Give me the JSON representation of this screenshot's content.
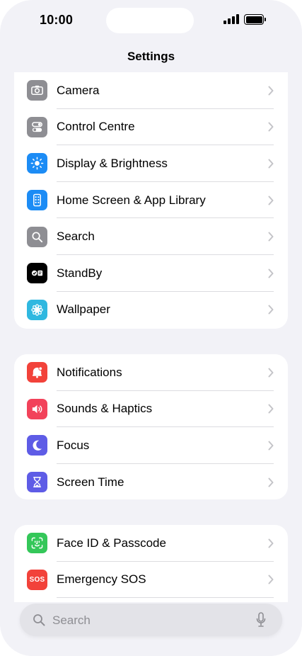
{
  "status_bar": {
    "time": "10:00"
  },
  "nav": {
    "title": "Settings"
  },
  "groups": [
    {
      "items": [
        {
          "label": "Camera",
          "icon": "camera-icon",
          "color": "#8e8e93"
        },
        {
          "label": "Control Centre",
          "icon": "toggles-icon",
          "color": "#8e8e93"
        },
        {
          "label": "Display & Brightness",
          "icon": "sun-icon",
          "color": "#1c8cf5"
        },
        {
          "label": "Home Screen & App Library",
          "icon": "phone-grid-icon",
          "color": "#1c8cf5"
        },
        {
          "label": "Search",
          "icon": "magnifier-icon",
          "color": "#8e8e93"
        },
        {
          "label": "StandBy",
          "icon": "standby-icon",
          "color": "#000000"
        },
        {
          "label": "Wallpaper",
          "icon": "flower-icon",
          "color": "#2fb8e0"
        }
      ]
    },
    {
      "items": [
        {
          "label": "Notifications",
          "icon": "bell-icon",
          "color": "#f2423a"
        },
        {
          "label": "Sounds & Haptics",
          "icon": "speaker-icon",
          "color": "#f2425a"
        },
        {
          "label": "Focus",
          "icon": "moon-icon",
          "color": "#5e5ce6"
        },
        {
          "label": "Screen Time",
          "icon": "hourglass-icon",
          "color": "#5e5ce6"
        }
      ]
    },
    {
      "items": [
        {
          "label": "Face ID & Passcode",
          "icon": "faceid-icon",
          "color": "#34c759"
        },
        {
          "label": "Emergency SOS",
          "icon": "sos-icon",
          "color": "#f2423a",
          "badge": "SOS"
        }
      ]
    }
  ],
  "search": {
    "placeholder": "Search"
  }
}
